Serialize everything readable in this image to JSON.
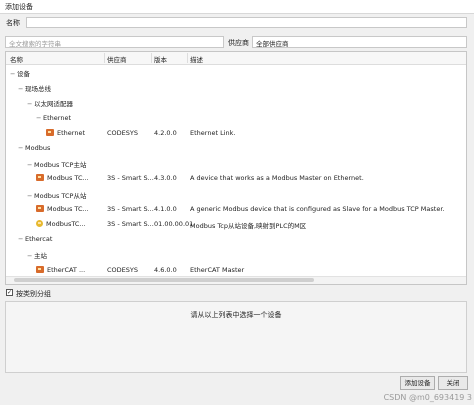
{
  "window": {
    "title": "添加设备"
  },
  "name_row": {
    "label": "名称"
  },
  "search": {
    "placeholder": "全文搜索的字符串",
    "vendor_label": "供应商",
    "vendor_value": "全部供应商"
  },
  "columns": [
    "名称",
    "供应商",
    "版本",
    "描述"
  ],
  "tree": [
    {
      "label": "设备",
      "level": 0,
      "toggle": "−"
    },
    {
      "label": "现场总线",
      "level": 1,
      "toggle": "−"
    },
    {
      "label": "以太网适配器",
      "level": 2,
      "toggle": "−"
    },
    {
      "label": "Ethernet",
      "level": 3,
      "toggle": "−"
    },
    {
      "label": "Ethernet",
      "level": 4,
      "toggle": "",
      "vendor": "CODESYS",
      "version": "4.2.0.0",
      "description": "Ethernet Link.",
      "icon": "device-icon"
    },
    {
      "label": "Modbus",
      "level": 1,
      "toggle": "−"
    },
    {
      "label": "Modbus TCP主站",
      "level": 2,
      "toggle": "−"
    },
    {
      "label": "Modbus TC...",
      "level": 3,
      "toggle": "",
      "vendor": "3S - Smart S...",
      "version": "4.3.0.0",
      "description": "A device that works as a Modbus Master on Ethernet.",
      "icon": "device-icon"
    },
    {
      "label": "Modbus TCP从站",
      "level": 2,
      "toggle": "−"
    },
    {
      "label": "Modbus TC...",
      "level": 3,
      "toggle": "",
      "vendor": "3S - Smart S...",
      "version": "4.1.0.0",
      "description": "A generic Modbus device that is configured as Slave for a Modbus TCP Master.",
      "icon": "device-icon"
    },
    {
      "label": "ModbusTC...",
      "level": 3,
      "toggle": "",
      "vendor": "3S - Smart S...",
      "version": "01.00.00.01",
      "description": "Modbus Tcp从站设备,映射到PLC的M区",
      "icon": "gear-device-icon"
    },
    {
      "label": "Ethercat",
      "level": 1,
      "toggle": "−"
    },
    {
      "label": "主站",
      "level": 2,
      "toggle": "−"
    },
    {
      "label": "EtherCAT ...",
      "level": 3,
      "toggle": "",
      "vendor": "CODESYS",
      "version": "4.6.0.0",
      "description": "EtherCAT Master",
      "icon": "device-icon"
    }
  ],
  "group_by_category": {
    "label": "按类别分组",
    "checked": true
  },
  "description_panel": {
    "message": "请从以上列表中选择一个设备"
  },
  "buttons": {
    "add": "添加设备",
    "close": "关闭"
  },
  "watermark": "CSDN @m0_693419 3"
}
